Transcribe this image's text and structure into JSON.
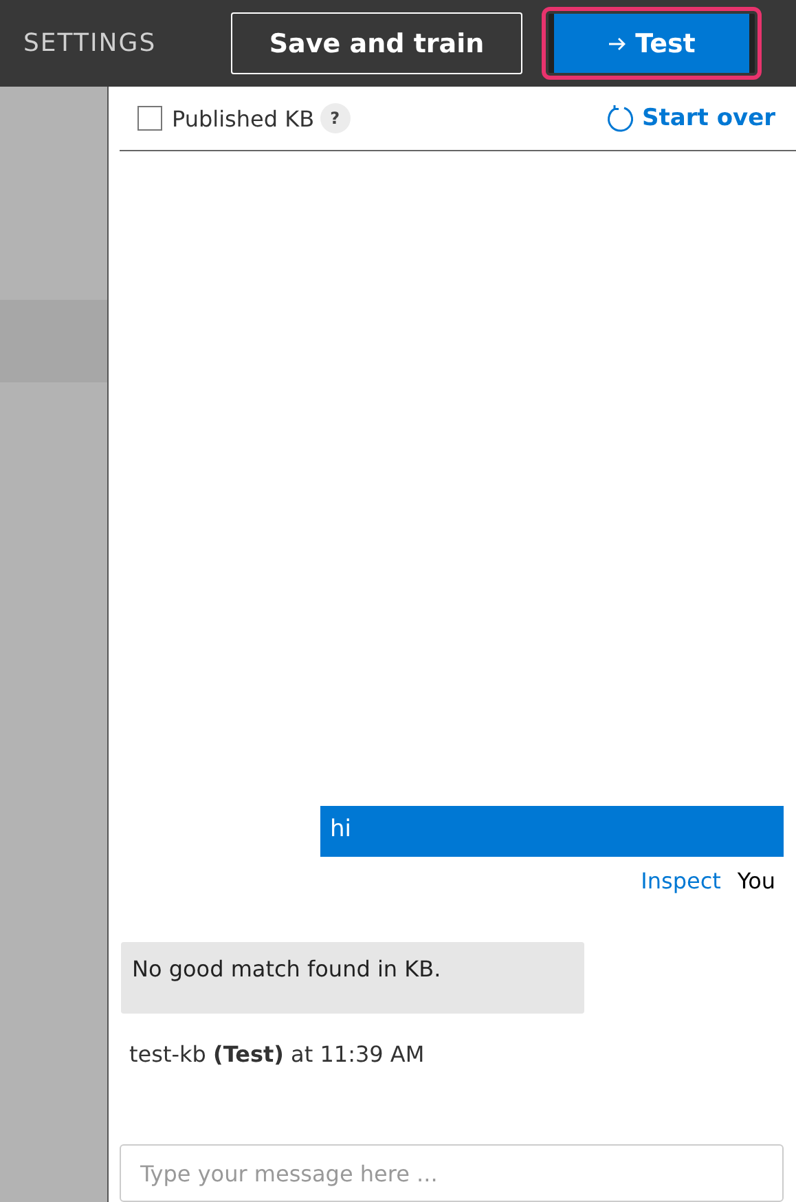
{
  "header": {
    "title": "SETTINGS",
    "buttons": [
      {
        "label": "Save and train",
        "kind": "outline",
        "focused": false
      },
      {
        "label": "Test",
        "kind": "primary",
        "focused": true
      }
    ]
  },
  "test_panel": {
    "published_kb": {
      "label": "Published KB",
      "checked": false,
      "help": "?"
    },
    "start_over": "Start over",
    "messages": [
      {
        "kind": "user",
        "text": "hi",
        "inspect": "Inspect",
        "sender": "You"
      },
      {
        "kind": "bot",
        "text": "No good match found in KB.",
        "footer": "test-kb **(Test)** at 11:39 AM"
      }
    ],
    "input": {
      "placeholder": "Type your message here ..."
    }
  }
}
